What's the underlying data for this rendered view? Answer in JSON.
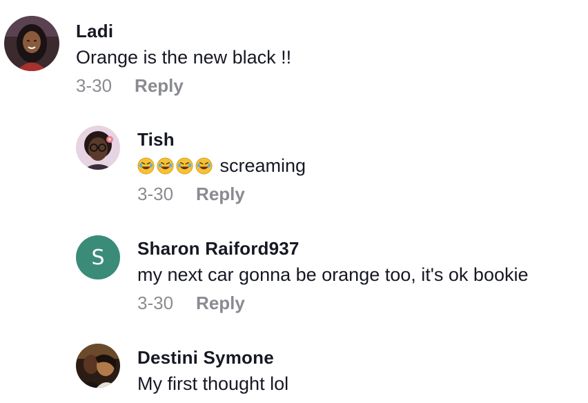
{
  "comments": [
    {
      "username": "Ladi",
      "text": "Orange is the new black !!",
      "date": "3-30",
      "reply_label": "Reply"
    },
    {
      "username": "Tish",
      "emojis": [
        "rofl-emoji",
        "rofl-emoji",
        "rofl-emoji",
        "rofl-emoji"
      ],
      "text": "screaming",
      "date": "3-30",
      "reply_label": "Reply"
    },
    {
      "username": "Sharon Raiford937",
      "avatar_letter": "S",
      "avatar_color": "#3a8c78",
      "text": "my next car gonna be orange too, it's ok bookie",
      "date": "3-30",
      "reply_label": "Reply"
    },
    {
      "username": "Destini Symone",
      "text": "My first thought lol"
    }
  ]
}
